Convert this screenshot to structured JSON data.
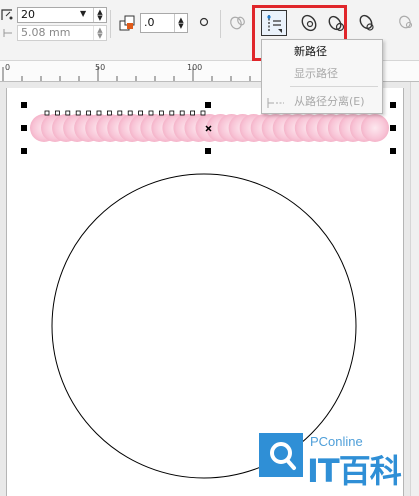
{
  "toolbar": {
    "height_value": "20",
    "width_value": "5.08 mm",
    "offset_value": ".0",
    "icons": [
      "corner-offset-icon",
      "color-fill-icon",
      "circle-node-icon",
      "path-properties-icon",
      "path-link-icon",
      "path-small-icon"
    ]
  },
  "path_menu": {
    "items": [
      {
        "label": "新路径",
        "enabled": true
      },
      {
        "label": "显示路径",
        "enabled": false
      },
      {
        "label": "从路径分离(E)",
        "enabled": false
      }
    ]
  },
  "ruler": {
    "labels": [
      "0",
      "50",
      "100"
    ]
  },
  "watermark": {
    "site": "PConline",
    "brand": "IT百科"
  },
  "colors": {
    "highlight": "#e0262b",
    "blend_pink": "#f8c8d8",
    "watermark_blue": "#2f8fd6"
  }
}
